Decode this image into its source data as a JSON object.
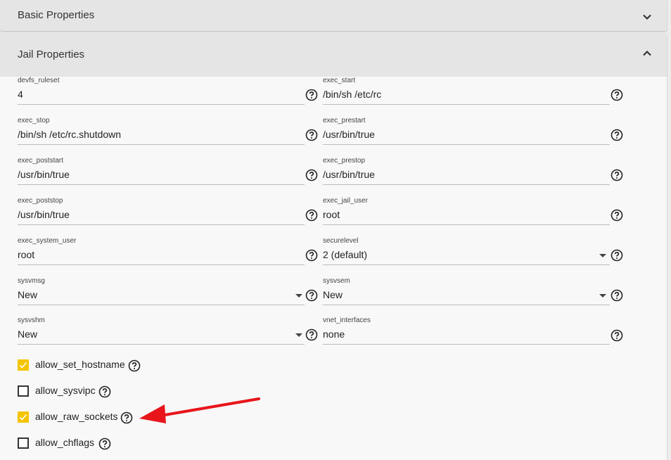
{
  "sections": {
    "basic": {
      "title": "Basic Properties",
      "expanded": false
    },
    "jail": {
      "title": "Jail Properties",
      "expanded": true
    }
  },
  "fields": {
    "devfs_ruleset": {
      "label": "devfs_ruleset",
      "value": "4"
    },
    "exec_start": {
      "label": "exec_start",
      "value": "/bin/sh /etc/rc"
    },
    "exec_stop": {
      "label": "exec_stop",
      "value": "/bin/sh /etc/rc.shutdown"
    },
    "exec_prestart": {
      "label": "exec_prestart",
      "value": "/usr/bin/true"
    },
    "exec_poststart": {
      "label": "exec_poststart",
      "value": "/usr/bin/true"
    },
    "exec_prestop": {
      "label": "exec_prestop",
      "value": "/usr/bin/true"
    },
    "exec_poststop": {
      "label": "exec_poststop",
      "value": "/usr/bin/true"
    },
    "exec_jail_user": {
      "label": "exec_jail_user",
      "value": "root"
    },
    "exec_system_user": {
      "label": "exec_system_user",
      "value": "root"
    },
    "securelevel": {
      "label": "securelevel",
      "value": "2 (default)"
    },
    "sysvmsg": {
      "label": "sysvmsg",
      "value": "New"
    },
    "sysvsem": {
      "label": "sysvsem",
      "value": "New"
    },
    "sysvshm": {
      "label": "sysvshm",
      "value": "New"
    },
    "vnet_interfaces": {
      "label": "vnet_interfaces",
      "value": "none"
    }
  },
  "checkboxes": {
    "allow_set_hostname": {
      "label": "allow_set_hostname",
      "checked": true
    },
    "allow_sysvipc": {
      "label": "allow_sysvipc",
      "checked": false
    },
    "allow_raw_sockets": {
      "label": "allow_raw_sockets",
      "checked": true
    },
    "allow_chflags": {
      "label": "allow_chflags",
      "checked": false
    }
  },
  "colors": {
    "accent_checkbox": "#f4c400",
    "annotation_arrow": "#e8151b"
  },
  "icons": {
    "help": "help-circle-icon",
    "expand": "chevron-down-icon",
    "collapse": "chevron-up-icon",
    "select": "dropdown-caret-icon"
  }
}
